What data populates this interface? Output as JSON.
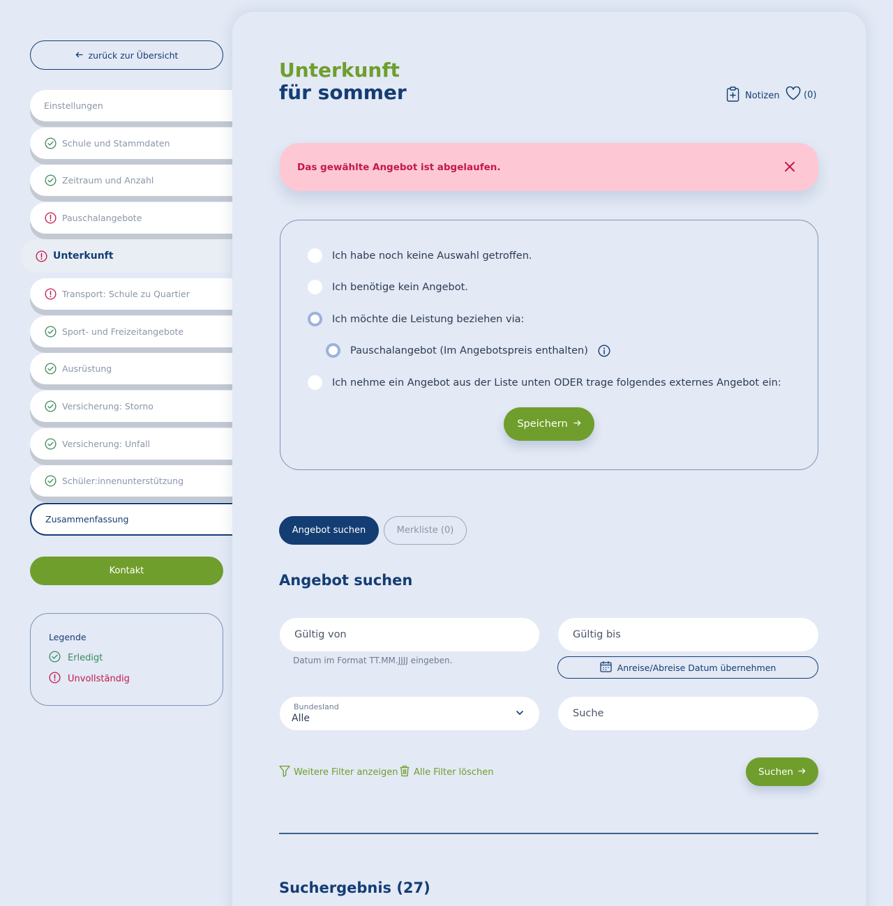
{
  "sidebar": {
    "back_label": "zurück zur Übersicht",
    "items": [
      {
        "label": "Einstellungen",
        "status": "none"
      },
      {
        "label": "Schule und Stammdaten",
        "status": "done"
      },
      {
        "label": "Zeitraum und Anzahl",
        "status": "done"
      },
      {
        "label": "Pauschalangebote",
        "status": "incomplete"
      },
      {
        "label": "Unterkunft",
        "status": "incomplete"
      },
      {
        "label": "Transport: Schule zu Quartier",
        "status": "incomplete"
      },
      {
        "label": "Sport- und Freizeitangebote",
        "status": "done"
      },
      {
        "label": "Ausrüstung",
        "status": "done"
      },
      {
        "label": "Versicherung: Storno",
        "status": "done"
      },
      {
        "label": "Versicherung: Unfall",
        "status": "done"
      },
      {
        "label": "Schüler:innenunterstützung",
        "status": "done"
      },
      {
        "label": "Zusammenfassung",
        "status": "none"
      }
    ],
    "kontakt_label": "Kontakt",
    "legend": {
      "title": "Legende",
      "done_label": "Erledigt",
      "incomplete_label": "Unvollständig"
    }
  },
  "header": {
    "title_line1": "Unterkunft",
    "title_line2": "für sommer",
    "notes_label": "Notizen",
    "favorites_count": "(0)"
  },
  "alert": {
    "message": "Das gewählte Angebot ist abgelaufen."
  },
  "options": {
    "items": [
      {
        "label": "Ich habe noch keine Auswahl getroffen.",
        "selected": false
      },
      {
        "label": "Ich benötige kein Angebot.",
        "selected": false
      },
      {
        "label": "Ich möchte die Leistung beziehen via:",
        "selected": true
      },
      {
        "label": "Pauschalangebot (Im Angebotspreis enthalten)",
        "selected": true
      },
      {
        "label": "Ich nehme ein Angebot aus der Liste unten ODER trage folgendes externes Angebot ein:",
        "selected": false
      }
    ],
    "save_label": "Speichern"
  },
  "tabs": [
    {
      "label": "Angebot suchen",
      "active": true
    },
    {
      "label": "Merkliste (0)",
      "active": false
    }
  ],
  "search": {
    "heading": "Angebot suchen",
    "valid_from_placeholder": "Gültig von",
    "valid_to_placeholder": "Gültig bis",
    "date_hint": "Datum im Format TT.MM.JJJJ eingeben.",
    "date_button_label": "Anreise/Abreise Datum übernehmen",
    "state_label": "Bundesland",
    "state_value": "Alle",
    "query_placeholder": "Suche",
    "more_filters_label": "Weitere Filter anzeigen",
    "clear_filters_label": "Alle Filter löschen",
    "search_button_label": "Suchen"
  },
  "results": {
    "heading": "Suchergebnis (27)"
  },
  "colors": {
    "primary_blue": "#143d73",
    "primary_green": "#6f9e2c",
    "alert_bg": "#fdc8d3",
    "alert_text": "#c2194a",
    "background": "#e3e9f5"
  }
}
